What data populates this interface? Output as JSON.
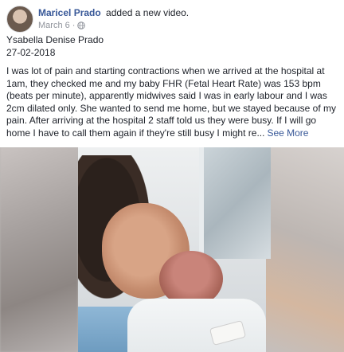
{
  "post": {
    "author_name": "Maricel Prado",
    "author_action": "added a new video.",
    "date": "March 6",
    "separator": "·",
    "privacy_icon": "globe-icon",
    "baby_name": "Ysabella Denise Prado",
    "birth_date": "27-02-2018",
    "text": "I was lot of pain and starting contractions when we arrived at the hospital at 1am, they checked me and my baby FHR (Fetal Heart Rate) was 153 bpm (beats per minute), apparently midwives said I was in early labour and I was 2cm dilated only. She wanted to send me home, but we stayed because of my pain. After arriving at the hospital 2 staff told us they were busy. If I will go home I have to call them again if they're still busy I might re...",
    "see_more_label": "See More"
  },
  "colors": {
    "link": "#385898",
    "text": "#1d2129",
    "meta": "#90949c"
  }
}
